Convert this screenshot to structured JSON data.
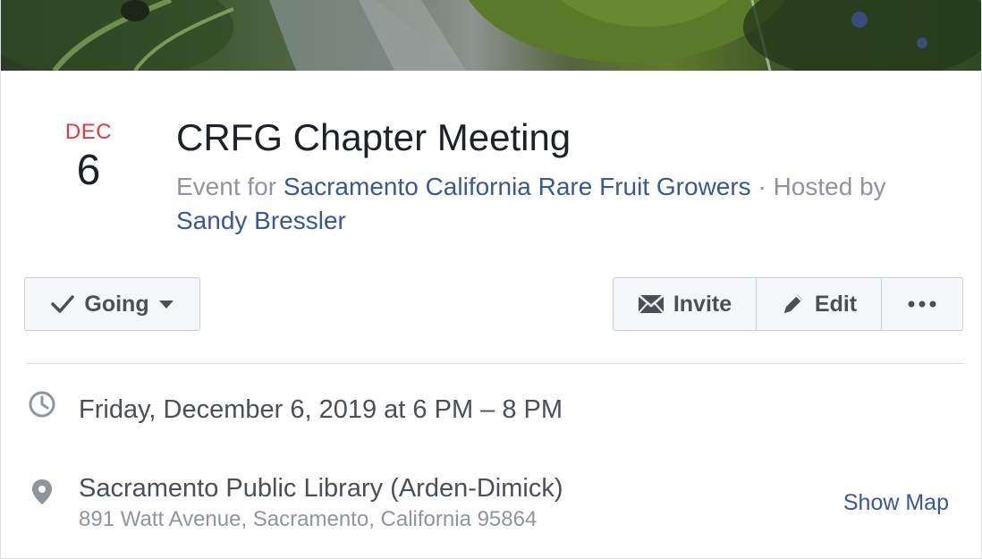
{
  "event": {
    "month": "DEC",
    "day": "6",
    "title": "CRFG Chapter Meeting",
    "event_for_prefix": "Event for",
    "group_name": "Sacramento California Rare Fruit Growers",
    "hosted_by_prefix": "· Hosted by",
    "host_name": "Sandy Bressler"
  },
  "actions": {
    "going_label": "Going",
    "invite_label": "Invite",
    "edit_label": "Edit"
  },
  "details": {
    "datetime": "Friday, December 6, 2019 at 6 PM – 8 PM",
    "place_name": "Sacramento Public Library (Arden-Dimick)",
    "place_address": "891 Watt Avenue, Sacramento, California 95864",
    "show_map_label": "Show Map"
  },
  "icons": {
    "going": "checkmark-icon",
    "dropdown": "caret-down-icon",
    "invite": "envelope-icon",
    "edit": "pencil-icon",
    "more": "more-dots-icon",
    "time": "clock-icon",
    "location": "map-pin-icon"
  },
  "colors": {
    "accent_link": "#385898",
    "month_red": "#e0393e",
    "text_primary": "#1d2129",
    "text_secondary": "#90949c",
    "button_bg": "#f5f6f7",
    "border": "#ccd0d5"
  }
}
